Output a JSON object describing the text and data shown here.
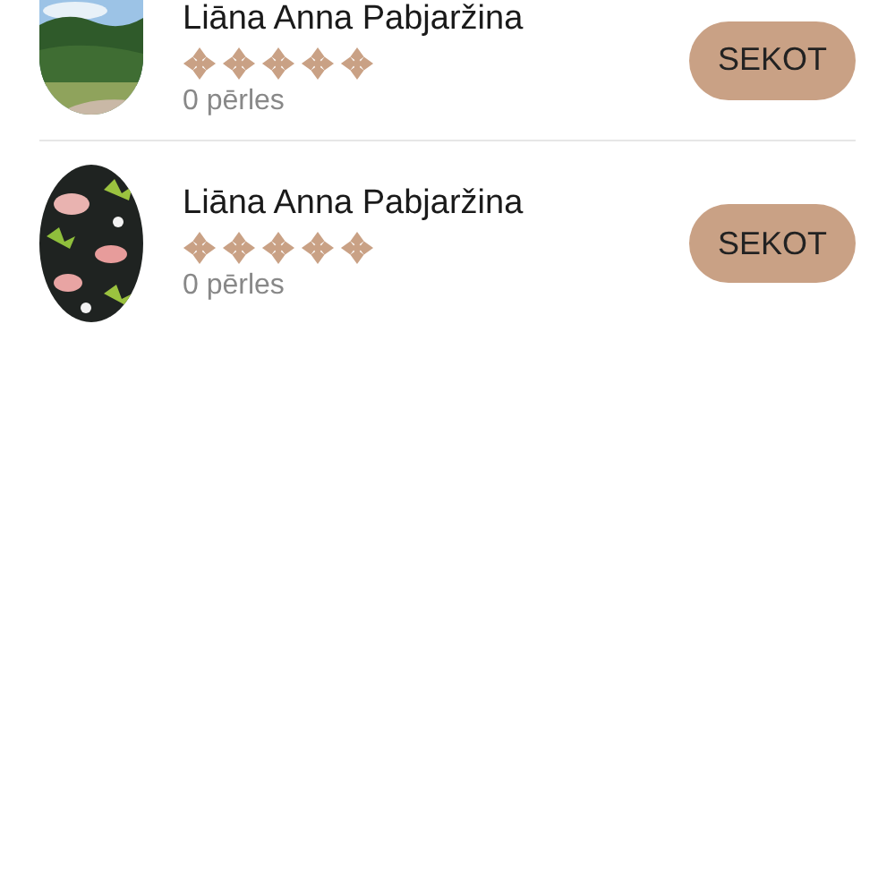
{
  "users": [
    {
      "name": "Liāna Anna Pabjaržina",
      "stars": 5,
      "pearls": "0 pērles",
      "button": "SEKOT"
    },
    {
      "name": "Liāna Anna Pabjaržina",
      "stars": 5,
      "pearls": "0 pērles",
      "button": "SEKOT"
    }
  ]
}
